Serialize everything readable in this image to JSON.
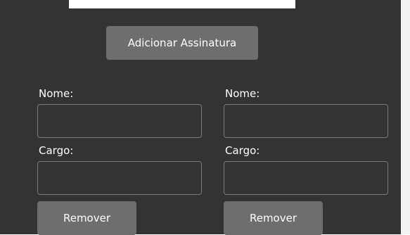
{
  "toolbar": {
    "add_signature_label": "Adicionar Assinatura"
  },
  "signatures": [
    {
      "name_label": "Nome:",
      "name_value": "",
      "role_label": "Cargo:",
      "role_value": "",
      "remove_label": "Remover"
    },
    {
      "name_label": "Nome:",
      "name_value": "",
      "role_label": "Cargo:",
      "role_value": "",
      "remove_label": "Remover"
    }
  ],
  "colors": {
    "panel_background": "#333333",
    "button_background": "#6e6e6e",
    "field_border": "#7a7a7a",
    "text": "#ffffff"
  }
}
